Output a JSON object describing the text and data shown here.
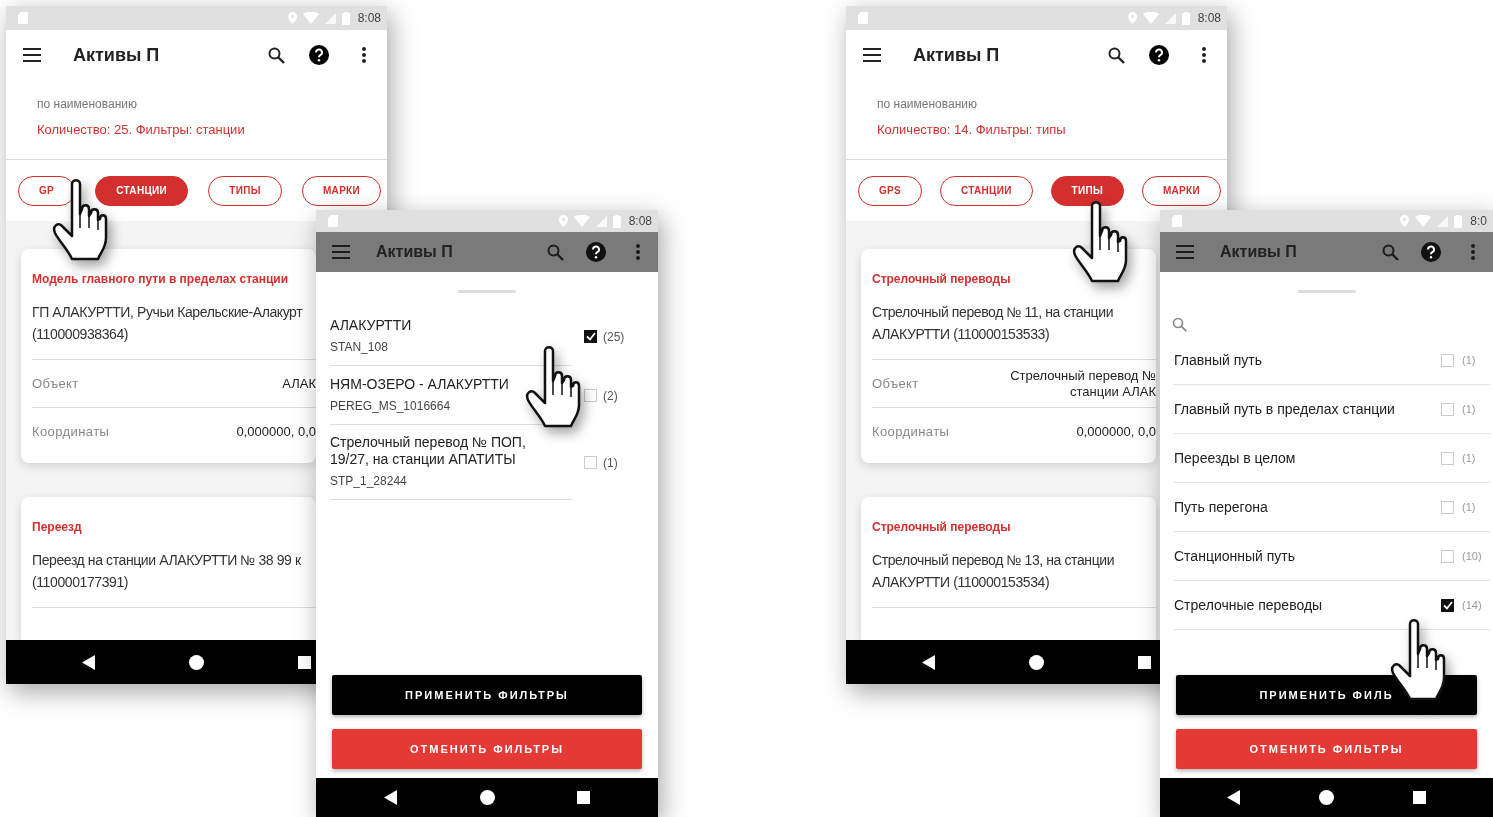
{
  "screens": [
    {
      "kind": "list",
      "status_time": "8:08",
      "title": "Активы П",
      "sort_label": "по наименованию",
      "summary": "Количество: 25. Фильтры: станции",
      "chips": [
        {
          "label": "GP",
          "selected": false
        },
        {
          "label": "СТАНЦИИ",
          "selected": true
        },
        {
          "label": "ТИПЫ",
          "selected": false
        },
        {
          "label": "МАРКИ",
          "selected": false
        }
      ],
      "cards": [
        {
          "type": "Модель главного пути в пределах станции",
          "name": "ГП АЛАКУРТТИ, Ручьи Карельские-Алакурт\n(110000938364)",
          "fields": [
            {
              "label": "Объект",
              "value": "АЛАК"
            },
            {
              "label": "Координаты",
              "value": "0,000000, 0,0"
            }
          ]
        },
        {
          "type": "Переезд",
          "name": "Переезд на станции АЛАКУРТТИ № 38 99 к\n(110000177391)"
        }
      ]
    },
    {
      "kind": "sheet",
      "status_time": "8:08",
      "title": "Активы П",
      "has_search": false,
      "options": [
        {
          "name": "АЛАКУРТТИ",
          "code": "STAN_108",
          "count": "(25)",
          "checked": true
        },
        {
          "name": "НЯМ-ОЗЕРО - АЛАКУРТТИ",
          "code": "PEREG_MS_1016664",
          "count": "(2)",
          "checked": false
        },
        {
          "name": "Стрелочный перевод № ПОП,\n19/27, на станции АПАТИТЫ",
          "code": "STP_1_28244",
          "count": "(1)",
          "checked": false
        }
      ],
      "apply": "ПРИМЕНИТЬ ФИЛЬТРЫ",
      "cancel": "ОТМЕНИТЬ ФИЛЬТРЫ"
    },
    {
      "kind": "list",
      "status_time": "8:08",
      "title": "Активы П",
      "sort_label": "по наименованию",
      "summary": "Количество: 14. Фильтры: типы",
      "chips": [
        {
          "label": "GPS",
          "selected": false
        },
        {
          "label": "СТАНЦИИ",
          "selected": false
        },
        {
          "label": "ТИПЫ",
          "selected": true
        },
        {
          "label": "МАРКИ",
          "selected": false
        }
      ],
      "cards": [
        {
          "type": "Стрелочный переводы",
          "name": "Стрелочный перевод № 11, на станции\nАЛАКУРТТИ (110000153533)",
          "fields": [
            {
              "label": "Объект",
              "value": "Стрелочный перевод №\nстанции АЛАК"
            },
            {
              "label": "Координаты",
              "value": "0,000000, 0,0"
            }
          ]
        },
        {
          "type": "Стрелочный переводы",
          "name": "Стрелочный перевод № 13, на станции\nАЛАКУРТТИ (110000153534)"
        }
      ]
    },
    {
      "kind": "sheet",
      "status_time": "8:0",
      "title": "Активы П",
      "has_search": true,
      "options": [
        {
          "name": "Главный путь",
          "count": "(1)",
          "checked": false
        },
        {
          "name": "Главный путь в пределах станции",
          "count": "(1)",
          "checked": false
        },
        {
          "name": "Переезды в целом",
          "count": "(1)",
          "checked": false
        },
        {
          "name": "Путь перегона",
          "count": "(1)",
          "checked": false
        },
        {
          "name": "Станционный путь",
          "count": "(10)",
          "checked": false
        },
        {
          "name": "Стрелочные переводы",
          "count": "(14)",
          "checked": true
        }
      ],
      "apply": "ПРИМЕНИТЬ ФИЛЬ",
      "cancel": "ОТМЕНИТЬ ФИЛЬТРЫ"
    }
  ]
}
